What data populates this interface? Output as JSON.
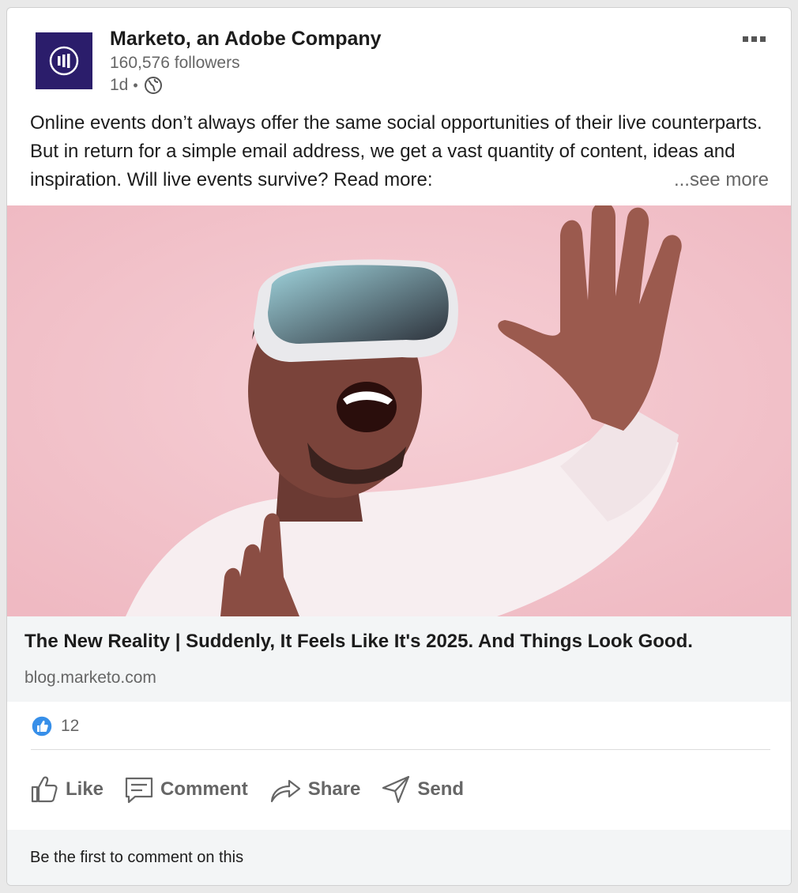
{
  "post": {
    "author": {
      "name": "Marketo, an Adobe Company",
      "followers": "160,576 followers",
      "time": "1d",
      "separator": "•",
      "visibility_icon": "globe-icon",
      "logo_icon": "marketo-logo",
      "logo_color": "#2b1d6b"
    },
    "menu_icon": "more-options-icon",
    "text": "Online events don’t always offer the same social opportunities of their live counterparts. But in return for a simple email address, we get a vast quantity of content, ideas and inspiration. Will live events survive? Read more:",
    "see_more_label": "...see more",
    "image": {
      "description_icon": "vr-headset-photo",
      "background_color": "#f4c6cd"
    },
    "link": {
      "title": "The New Reality | Suddenly, It Feels Like It's 2025. And Things Look Good.",
      "domain": "blog.marketo.com"
    },
    "reactions": {
      "icon": "like-reaction-icon",
      "count": "12"
    },
    "actions": [
      {
        "label": "Like",
        "icon": "thumbs-up-icon"
      },
      {
        "label": "Comment",
        "icon": "comment-icon"
      },
      {
        "label": "Share",
        "icon": "share-icon"
      },
      {
        "label": "Send",
        "icon": "send-icon"
      }
    ],
    "comment_prompt": "Be the first to comment on this"
  },
  "colors": {
    "text_primary": "#1c1c1c",
    "text_secondary": "#666666",
    "link_box_bg": "#f3f5f6",
    "reaction_blue": "#378fe9"
  }
}
